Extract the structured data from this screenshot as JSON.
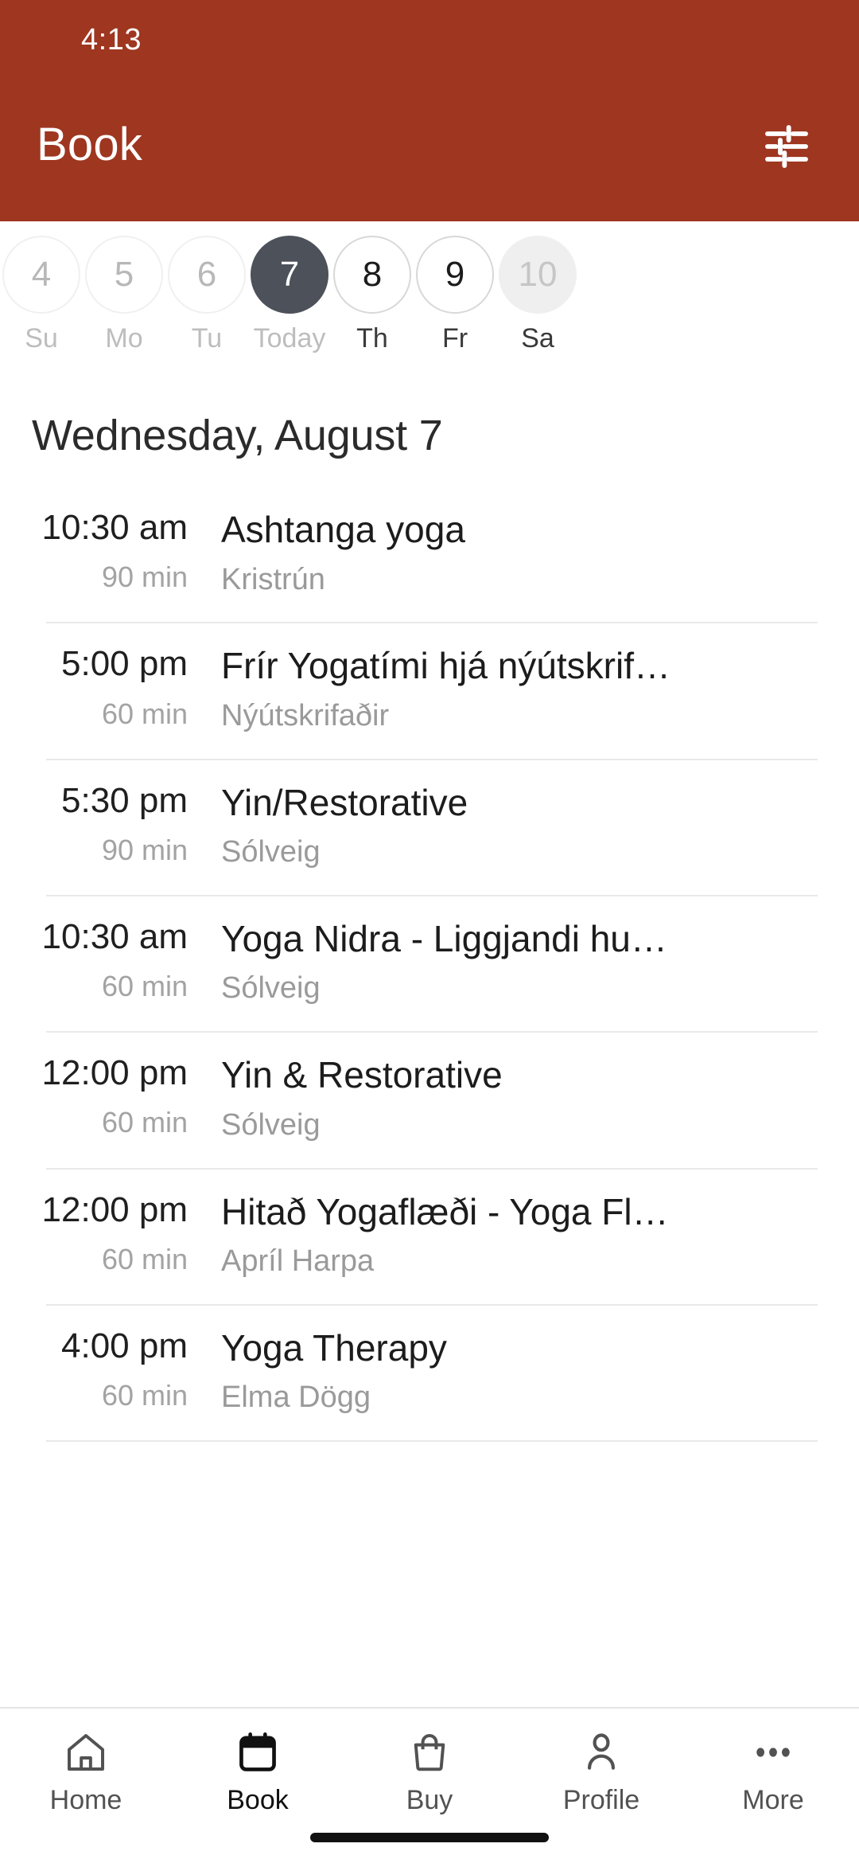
{
  "status_bar": {
    "time": "4:13"
  },
  "header": {
    "title": "Book",
    "background_color": "#9E3620",
    "filter_icon": "tune-sliders-icon"
  },
  "date_strip": {
    "days": [
      {
        "number": "4",
        "label": "Su",
        "state": "past"
      },
      {
        "number": "5",
        "label": "Mo",
        "state": "past"
      },
      {
        "number": "6",
        "label": "Tu",
        "state": "past"
      },
      {
        "number": "7",
        "label": "Today",
        "state": "selected"
      },
      {
        "number": "8",
        "label": "Th",
        "state": "future"
      },
      {
        "number": "9",
        "label": "Fr",
        "state": "future"
      },
      {
        "number": "10",
        "label": "Sa",
        "state": "disabled"
      }
    ],
    "selected_color": "#4C515A"
  },
  "day_heading": "Wednesday, August 7",
  "classes": [
    {
      "time": "10:30 am",
      "duration": "90 min",
      "title": "Ashtanga yoga",
      "teacher": "Kristrún"
    },
    {
      "time": "5:00 pm",
      "duration": "60 min",
      "title": "Frír Yogatími hjá nýútskrif…",
      "teacher": "Nýútskrifaðir"
    },
    {
      "time": "5:30 pm",
      "duration": "90 min",
      "title": "Yin/Restorative",
      "teacher": "Sólveig"
    },
    {
      "time": "10:30 am",
      "duration": "60 min",
      "title": "Yoga Nidra - Liggjandi hu…",
      "teacher": "Sólveig"
    },
    {
      "time": "12:00 pm",
      "duration": "60 min",
      "title": "Yin & Restorative",
      "teacher": "Sólveig"
    },
    {
      "time": "12:00 pm",
      "duration": "60 min",
      "title": "Hitað Yogaflæði - Yoga Fl…",
      "teacher": "Apríl Harpa"
    },
    {
      "time": "4:00 pm",
      "duration": "60 min",
      "title": "Yoga Therapy",
      "teacher": "Elma Dögg"
    }
  ],
  "tab_bar": {
    "active": "Book",
    "items": [
      {
        "label": "Home",
        "icon": "home-icon"
      },
      {
        "label": "Book",
        "icon": "calendar-icon"
      },
      {
        "label": "Buy",
        "icon": "shopping-bag-icon"
      },
      {
        "label": "Profile",
        "icon": "person-icon"
      },
      {
        "label": "More",
        "icon": "more-dots-icon"
      }
    ]
  }
}
